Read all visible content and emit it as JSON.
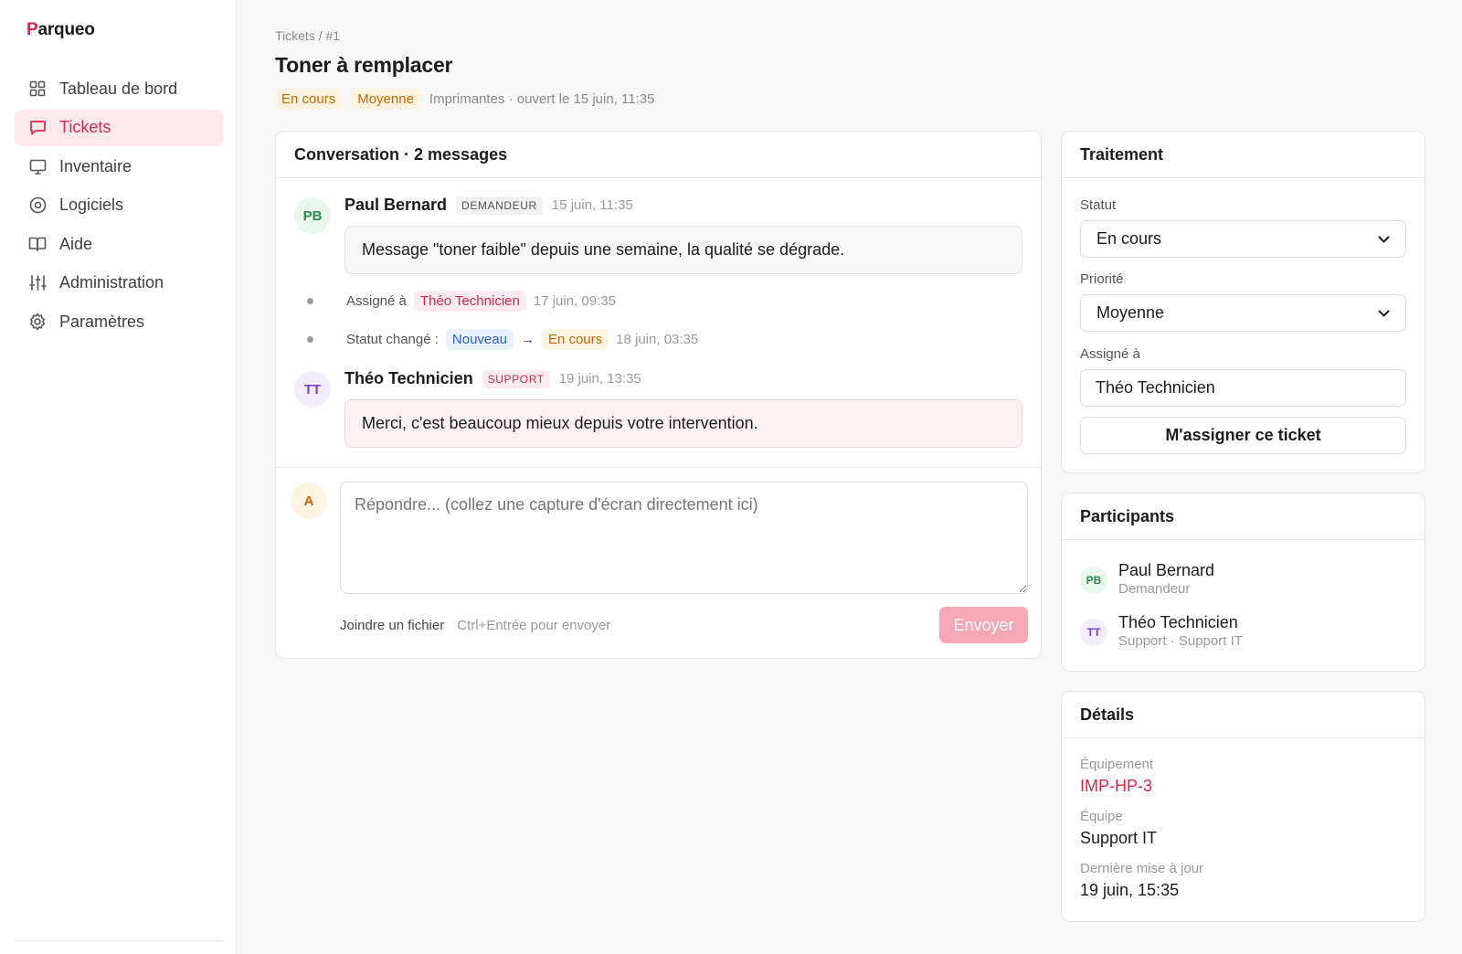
{
  "app": {
    "logo_initial": "P",
    "logo_rest": "arqueo",
    "brand_color": "#d7264f"
  },
  "sidebar": {
    "items": [
      {
        "label": "Tableau de bord",
        "icon": "grid-icon"
      },
      {
        "label": "Tickets",
        "icon": "chat-icon",
        "active": true
      },
      {
        "label": "Inventaire",
        "icon": "monitor-icon"
      },
      {
        "label": "Logiciels",
        "icon": "disc-icon"
      },
      {
        "label": "Aide",
        "icon": "book-icon"
      },
      {
        "label": "Administration",
        "icon": "sliders-icon"
      },
      {
        "label": "Paramètres",
        "icon": "gear-icon"
      }
    ]
  },
  "header": {
    "breadcrumb": "Tickets / #1",
    "title": "Toner à remplacer",
    "status_badge": "En cours",
    "priority_badge": "Moyenne",
    "meta": "Imprimantes · ouvert le 15 juin, 11:35"
  },
  "conversation": {
    "title": "Conversation · 2 messages",
    "message1": {
      "initials": "PB",
      "author": "Paul Bernard",
      "role": "DEMANDEUR",
      "time": "15 juin, 11:35",
      "text": "Message \"toner faible\" depuis une semaine, la qualité se dégrade."
    },
    "event1": {
      "prefix": "Assigné à",
      "badge": "Théo Technicien",
      "time": "17 juin, 09:35"
    },
    "event2": {
      "prefix": "Statut changé :",
      "from": "Nouveau",
      "arrow": "→",
      "to": "En cours",
      "time": "18 juin, 03:35"
    },
    "message2": {
      "initials": "TT",
      "author": "Théo Technicien",
      "role": "SUPPORT",
      "time": "19 juin, 13:35",
      "text": "Merci, c'est beaucoup mieux depuis votre intervention."
    },
    "reply": {
      "initials": "A",
      "placeholder": "Répondre... (collez une capture d'écran directement ici)",
      "attach_label": "Joindre un fichier",
      "hint": "Ctrl+Entrée pour envoyer",
      "send_label": "Envoyer"
    }
  },
  "treatment": {
    "title": "Traitement",
    "status_label": "Statut",
    "status_value": "En cours",
    "priority_label": "Priorité",
    "priority_value": "Moyenne",
    "assignee_label": "Assigné à",
    "assignee_value": "Théo Technicien",
    "assign_me_label": "M'assigner ce ticket"
  },
  "participants": {
    "title": "Participants",
    "items": [
      {
        "initials": "PB",
        "name": "Paul Bernard",
        "sub": "Demandeur"
      },
      {
        "initials": "TT",
        "name": "Théo Technicien",
        "sub": "Support · Support IT"
      }
    ]
  },
  "details": {
    "title": "Détails",
    "equipment_label": "Équipement",
    "equipment_value": "IMP-HP-3",
    "team_label": "Équipe",
    "team_value": "Support IT",
    "updated_label": "Dernière mise à jour",
    "updated_value": "19 juin, 15:35"
  }
}
